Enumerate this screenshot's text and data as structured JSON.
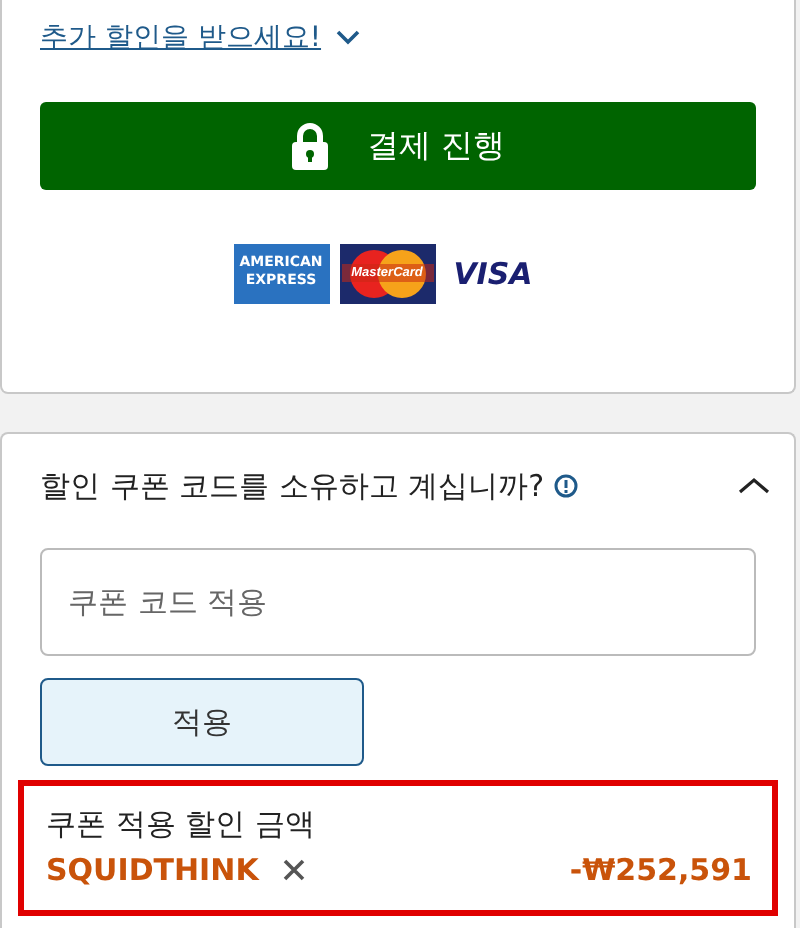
{
  "discount_link": {
    "label": "추가 할인을 받으세요!",
    "expanded": false
  },
  "checkout_button": "결제 진행",
  "payment_logos": [
    {
      "kind": "amex",
      "text": "AMERICAN EXPRESS"
    },
    {
      "kind": "mastercard",
      "text": "MasterCard"
    },
    {
      "kind": "visa",
      "text": "VISA"
    }
  ],
  "coupon": {
    "title": "할인 쿠폰 코드를 소유하고 계십니까?",
    "expanded": true,
    "placeholder": "쿠폰 코드 적용",
    "apply_button": "적용",
    "applied": {
      "label": "쿠폰 적용 할인 금액",
      "code": "SQUIDTHINK",
      "amount": "-₩252,591",
      "highlighted": true
    }
  }
}
